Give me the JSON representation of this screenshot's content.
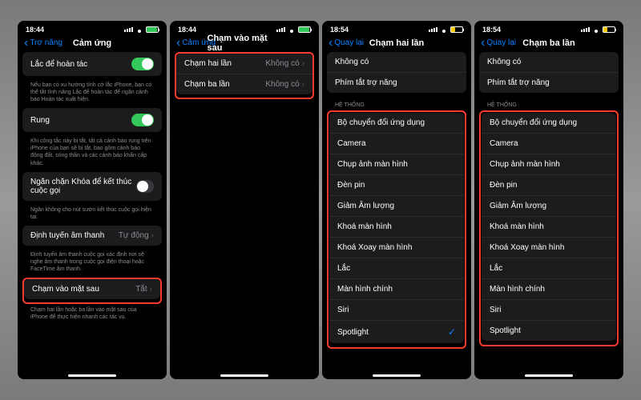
{
  "phones": [
    {
      "time": "18:44",
      "battery": "green",
      "back": "Trợ năng",
      "title": "Cảm ứng",
      "groups": [
        {
          "cells": [
            {
              "label": "Lắc để hoàn tác",
              "type": "toggle",
              "on": true
            }
          ],
          "footer": "Nếu bạn có xu hướng tình cờ lắc iPhone, bạn có thể tắt tính năng Lắc để hoàn tác để ngăn cảnh báo Hoàn tác xuất hiện."
        },
        {
          "cells": [
            {
              "label": "Rung",
              "type": "toggle",
              "on": true
            }
          ],
          "footer": "Khi công tắc này bị tắt, tất cả cảnh báo rung trên iPhone của bạn sẽ bị tắt, bao gồm cảnh báo động đất, sóng thần và các cảnh báo khẩn cấp khác."
        },
        {
          "cells": [
            {
              "label": "Ngăn chặn Khóa để kết thúc cuộc gọi",
              "type": "toggle",
              "on": false
            }
          ],
          "footer": "Ngăn không cho nút sườn kết thúc cuộc gọi hiện tại."
        },
        {
          "cells": [
            {
              "label": "Định tuyến âm thanh",
              "type": "link",
              "value": "Tự động"
            }
          ],
          "footer": "Định tuyến âm thanh cuộc gọi xác định nơi sẽ nghe âm thanh trong cuộc gọi điện thoại hoặc FaceTime âm thanh."
        },
        {
          "highlight": true,
          "cells": [
            {
              "label": "Chạm vào mặt sau",
              "type": "link",
              "value": "Tắt"
            }
          ],
          "footer": "Chạm hai lần hoặc ba lần vào mặt sau của iPhone để thực hiện nhanh các tác vụ."
        }
      ]
    },
    {
      "time": "18:44",
      "battery": "green",
      "back": "Cảm ứng",
      "title": "Chạm vào mặt sau",
      "groups": [
        {
          "highlight": true,
          "cells": [
            {
              "label": "Chạm hai lần",
              "type": "link",
              "value": "Không có"
            },
            {
              "label": "Chạm ba lần",
              "type": "link",
              "value": "Không có"
            }
          ]
        }
      ]
    },
    {
      "time": "18:54",
      "battery": "yellow",
      "back": "Quay lại",
      "title": "Chạm hai lần",
      "topGroup": {
        "cells": [
          {
            "label": "Không có",
            "type": "item"
          },
          {
            "label": "Phím tắt trợ năng",
            "type": "item"
          }
        ]
      },
      "sectionHeader": "HỆ THỐNG",
      "systemGroup": {
        "highlight": true,
        "cells": [
          {
            "label": "Bộ chuyển đổi ứng dụng",
            "type": "item"
          },
          {
            "label": "Camera",
            "type": "item"
          },
          {
            "label": "Chụp ảnh màn hình",
            "type": "item"
          },
          {
            "label": "Đèn pin",
            "type": "item"
          },
          {
            "label": "Giảm Âm lượng",
            "type": "item"
          },
          {
            "label": "Khoá màn hình",
            "type": "item"
          },
          {
            "label": "Khoá Xoay màn hình",
            "type": "item"
          },
          {
            "label": "Lắc",
            "type": "item"
          },
          {
            "label": "Màn hình chính",
            "type": "item"
          },
          {
            "label": "Siri",
            "type": "item"
          },
          {
            "label": "Spotlight",
            "type": "item",
            "checked": true
          }
        ]
      }
    },
    {
      "time": "18:54",
      "battery": "yellow",
      "back": "Quay lại",
      "title": "Chạm ba lần",
      "topGroup": {
        "cells": [
          {
            "label": "Không có",
            "type": "item"
          },
          {
            "label": "Phím tắt trợ năng",
            "type": "item"
          }
        ]
      },
      "sectionHeader": "HỆ THỐNG",
      "systemGroup": {
        "highlight": true,
        "cells": [
          {
            "label": "Bộ chuyển đổi ứng dụng",
            "type": "item"
          },
          {
            "label": "Camera",
            "type": "item"
          },
          {
            "label": "Chụp ảnh màn hình",
            "type": "item"
          },
          {
            "label": "Đèn pin",
            "type": "item"
          },
          {
            "label": "Giảm Âm lượng",
            "type": "item"
          },
          {
            "label": "Khoá màn hình",
            "type": "item"
          },
          {
            "label": "Khoá Xoay màn hình",
            "type": "item"
          },
          {
            "label": "Lắc",
            "type": "item"
          },
          {
            "label": "Màn hình chính",
            "type": "item"
          },
          {
            "label": "Siri",
            "type": "item"
          },
          {
            "label": "Spotlight",
            "type": "item"
          }
        ]
      }
    }
  ]
}
